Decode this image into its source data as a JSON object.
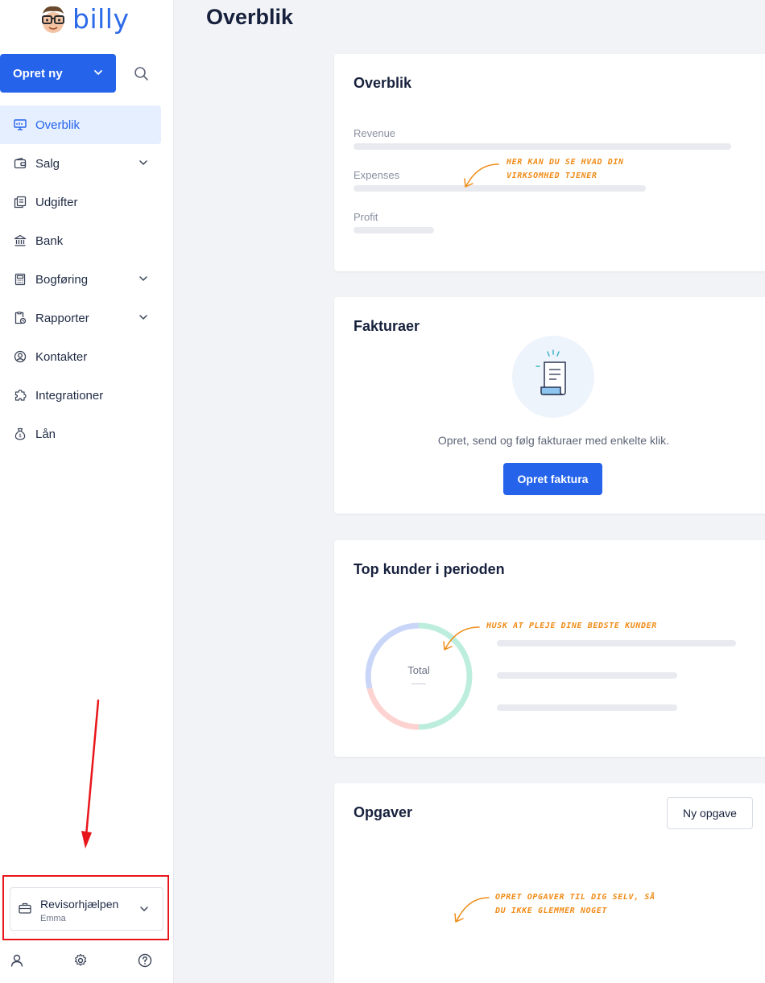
{
  "app": {
    "logo_text": "billy"
  },
  "sidebar": {
    "create_label": "Opret ny",
    "items": [
      {
        "label": "Overblik",
        "icon": "dashboard-icon",
        "active": true,
        "expandable": false
      },
      {
        "label": "Salg",
        "icon": "wallet-icon",
        "active": false,
        "expandable": true
      },
      {
        "label": "Udgifter",
        "icon": "receipts-icon",
        "active": false,
        "expandable": false
      },
      {
        "label": "Bank",
        "icon": "bank-icon",
        "active": false,
        "expandable": false
      },
      {
        "label": "Bogføring",
        "icon": "calculator-icon",
        "active": false,
        "expandable": true
      },
      {
        "label": "Rapporter",
        "icon": "report-icon",
        "active": false,
        "expandable": true
      },
      {
        "label": "Kontakter",
        "icon": "contact-icon",
        "active": false,
        "expandable": false
      },
      {
        "label": "Integrationer",
        "icon": "puzzle-icon",
        "active": false,
        "expandable": false
      },
      {
        "label": "Lån",
        "icon": "money-bag-icon",
        "active": false,
        "expandable": false
      }
    ],
    "organization": {
      "name": "Revisorhjælpen",
      "user": "Emma"
    }
  },
  "main": {
    "title": "Overblik",
    "overview_card": {
      "title": "Overblik",
      "metrics": [
        "Revenue",
        "Expenses",
        "Profit"
      ],
      "hint_line1": "Her kan du se hvad din",
      "hint_line2": "virksomhed tjener"
    },
    "invoices_card": {
      "title": "Fakturaer",
      "description": "Opret, send og følg fakturaer med enkelte klik.",
      "button_label": "Opret faktura"
    },
    "customers_card": {
      "title": "Top kunder i perioden",
      "donut_label": "Total",
      "hint": "Husk at pleje dine bedste kunder"
    },
    "tasks_card": {
      "title": "Opgaver",
      "button_label": "Ny opgave",
      "hint_line1": "Opret opgaver til dig selv, så",
      "hint_line2": "du ikke glemmer noget"
    }
  },
  "colors": {
    "accent": "#2563eb",
    "active_bg": "#e5efff",
    "hint": "#f08c18",
    "highlight": "#e8161b"
  }
}
